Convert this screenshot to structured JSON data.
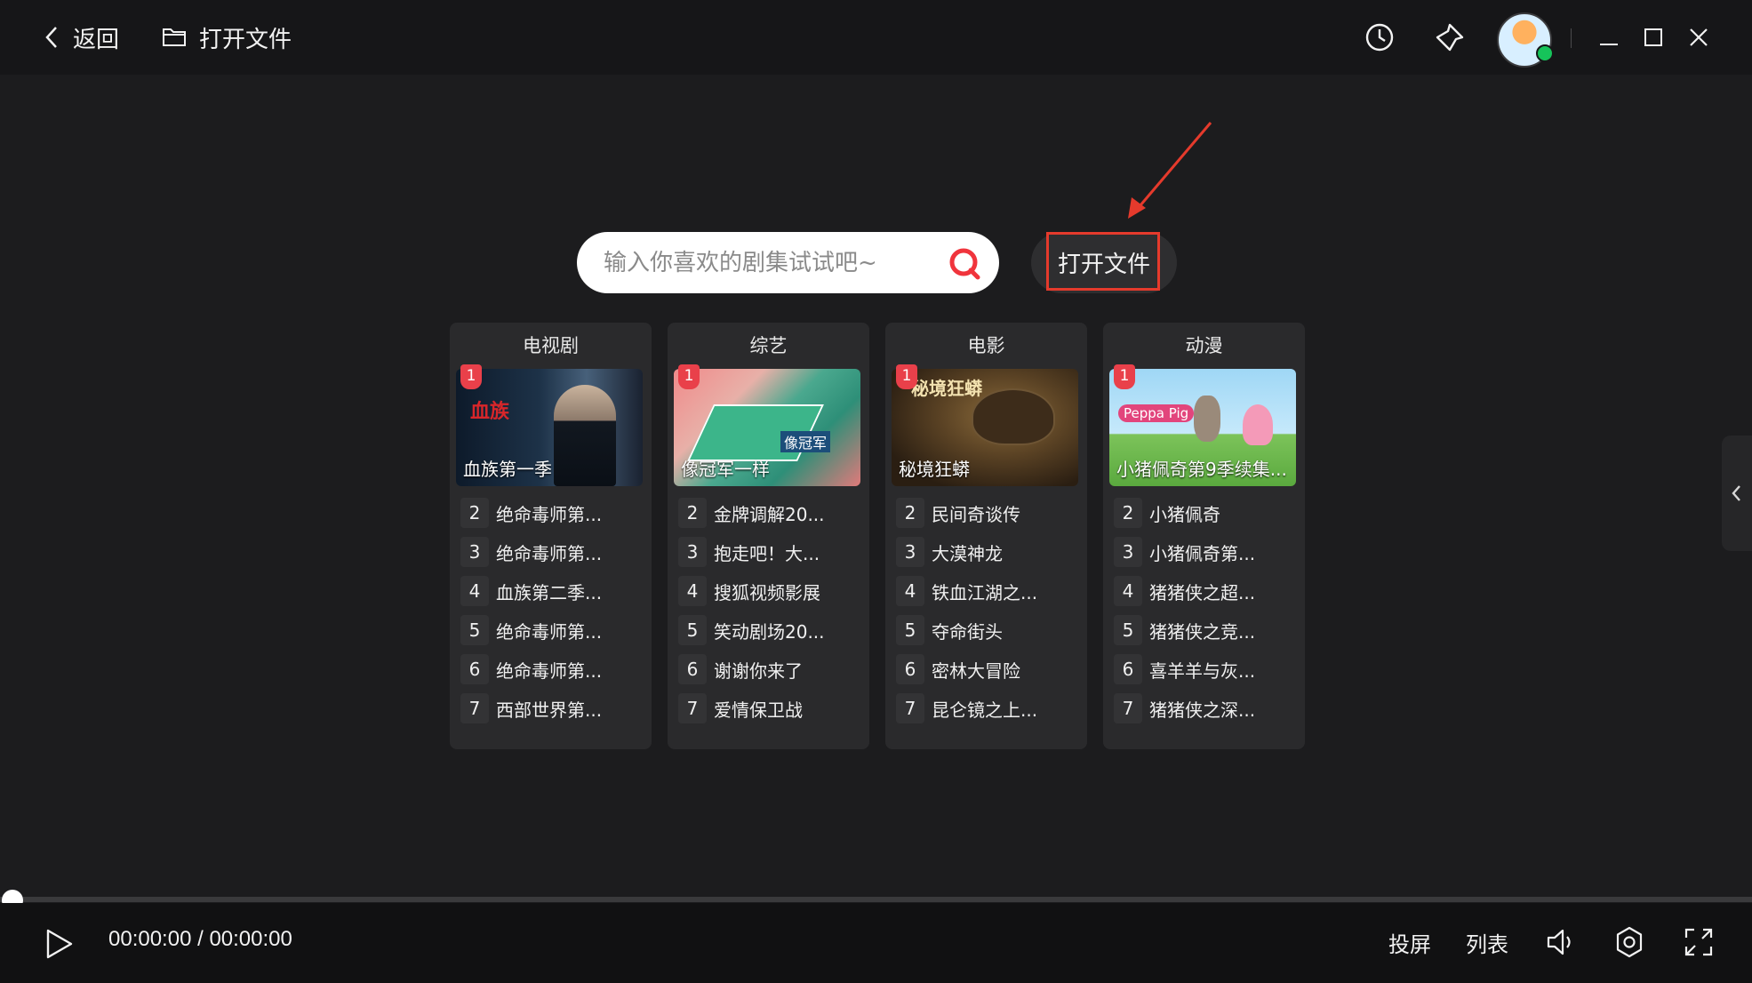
{
  "topbar": {
    "back_label": "返回",
    "open_label": "打开文件",
    "icons": [
      "history-icon",
      "pin-icon",
      "avatar",
      "minimize-icon",
      "maximize-icon",
      "close-icon"
    ]
  },
  "search": {
    "placeholder": "输入你喜欢的剧集试试吧~",
    "value": ""
  },
  "open_button_label": "打开文件",
  "categories": [
    {
      "title": "电视剧",
      "featured": {
        "rank": "1",
        "caption": "血族第一季",
        "poster_text": "血族"
      },
      "items": [
        {
          "rank": "2",
          "title": "绝命毒师第..."
        },
        {
          "rank": "3",
          "title": "绝命毒师第..."
        },
        {
          "rank": "4",
          "title": "血族第二季..."
        },
        {
          "rank": "5",
          "title": "绝命毒师第..."
        },
        {
          "rank": "6",
          "title": "绝命毒师第..."
        },
        {
          "rank": "7",
          "title": "西部世界第..."
        }
      ]
    },
    {
      "title": "综艺",
      "featured": {
        "rank": "1",
        "caption": "像冠军一样",
        "poster_text": "像冠军"
      },
      "items": [
        {
          "rank": "2",
          "title": "金牌调解20..."
        },
        {
          "rank": "3",
          "title": "抱走吧！大..."
        },
        {
          "rank": "4",
          "title": "搜狐视频影展"
        },
        {
          "rank": "5",
          "title": "笑动剧场20..."
        },
        {
          "rank": "6",
          "title": "谢谢你来了"
        },
        {
          "rank": "7",
          "title": "爱情保卫战"
        }
      ]
    },
    {
      "title": "电影",
      "featured": {
        "rank": "1",
        "caption": "秘境狂蟒",
        "poster_text": "秘境狂蟒"
      },
      "items": [
        {
          "rank": "2",
          "title": "民间奇谈传"
        },
        {
          "rank": "3",
          "title": "大漠神龙"
        },
        {
          "rank": "4",
          "title": "铁血江湖之..."
        },
        {
          "rank": "5",
          "title": "夺命街头"
        },
        {
          "rank": "6",
          "title": "密林大冒险"
        },
        {
          "rank": "7",
          "title": "昆仑镜之上..."
        }
      ]
    },
    {
      "title": "动漫",
      "featured": {
        "rank": "1",
        "caption": "小猪佩奇第9季续集...",
        "poster_text": "Peppa Pig"
      },
      "items": [
        {
          "rank": "2",
          "title": "小猪佩奇"
        },
        {
          "rank": "3",
          "title": "小猪佩奇第..."
        },
        {
          "rank": "4",
          "title": "猪猪侠之超..."
        },
        {
          "rank": "5",
          "title": "猪猪侠之竞..."
        },
        {
          "rank": "6",
          "title": "喜羊羊与灰..."
        },
        {
          "rank": "7",
          "title": "猪猪侠之深..."
        }
      ]
    }
  ],
  "player": {
    "current_time": "00:00:00",
    "separator": "/",
    "total_time": "00:00:00",
    "progress": 0,
    "cast_label": "投屏",
    "list_label": "列表"
  },
  "colors": {
    "background": "#1c1c1e",
    "card": "#2a2a2c",
    "accent_red": "#e53a2c",
    "rank_badge": "#e9404a",
    "online_dot": "#16c45a"
  }
}
